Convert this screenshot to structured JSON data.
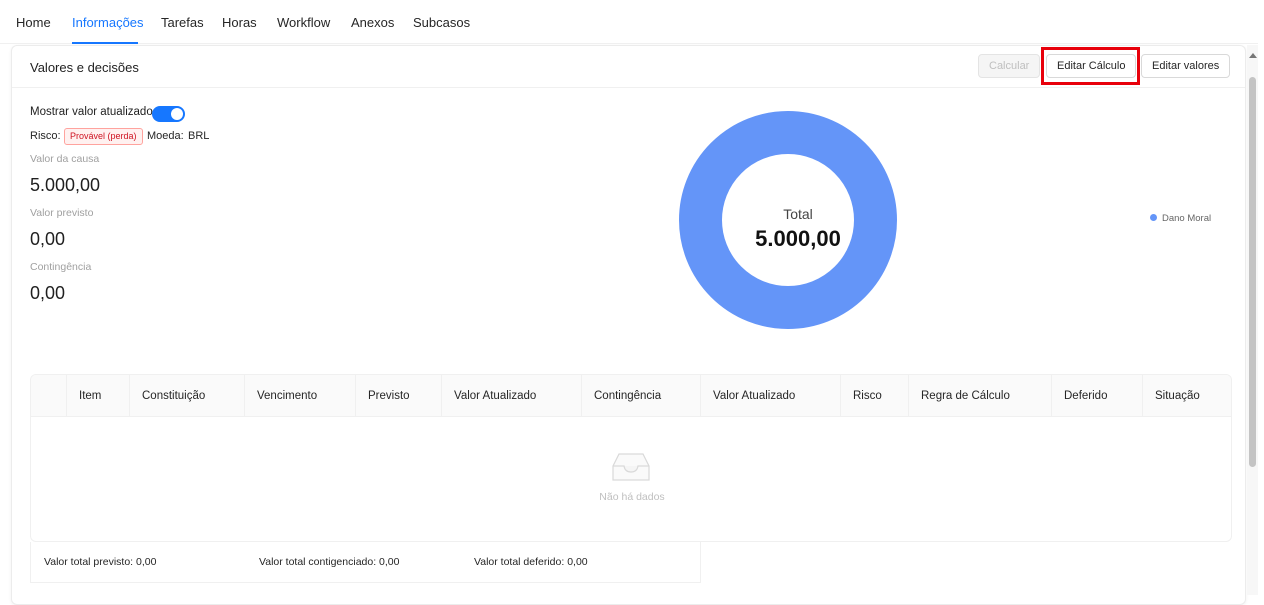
{
  "tabs": [
    {
      "label": "Home"
    },
    {
      "label": "Informações"
    },
    {
      "label": "Tarefas"
    },
    {
      "label": "Horas"
    },
    {
      "label": "Workflow"
    },
    {
      "label": "Anexos"
    },
    {
      "label": "Subcasos"
    }
  ],
  "active_tab": "Informações",
  "card": {
    "title": "Valores e decisões",
    "buttons": {
      "calcular": "Calcular",
      "editar_calculo": "Editar Cálculo",
      "editar_valores": "Editar valores"
    }
  },
  "summary": {
    "toggle_label": "Mostrar valor atualizado",
    "toggle_on": true,
    "risk_label": "Risco:",
    "risk_value": "Provável (perda)",
    "currency_label": "Moeda:",
    "currency_value": "BRL",
    "valor_causa_label": "Valor da causa",
    "valor_causa": "5.000,00",
    "valor_previsto_label": "Valor previsto",
    "valor_previsto": "0,00",
    "contingencia_label": "Contingência",
    "contingencia": "0,00"
  },
  "chart_data": {
    "type": "pie",
    "categories": [
      "Dano Moral"
    ],
    "values": [
      5000
    ],
    "center_label": "Total",
    "center_value": "5.000,00",
    "legend": [
      "Dano Moral"
    ],
    "legend_position": "right",
    "colors": [
      "#6495f8"
    ]
  },
  "table": {
    "columns": [
      "Item",
      "Constituição",
      "Vencimento",
      "Previsto",
      "Valor Atualizado",
      "Contingência",
      "Valor Atualizado",
      "Risco",
      "Regra de Cálculo",
      "Deferido",
      "Situação"
    ],
    "rows": [],
    "empty_text": "Não há dados"
  },
  "footer": {
    "total_previsto": "Valor total previsto: 0,00",
    "total_contingenciado": "Valor total contigenciado: 0,00",
    "total_deferido": "Valor total deferido: 0,00"
  },
  "colors": {
    "accent": "#1677ff",
    "highlight": "#e8000b",
    "risk_tag": "#cf1322",
    "chart_series": "#6495f8"
  }
}
